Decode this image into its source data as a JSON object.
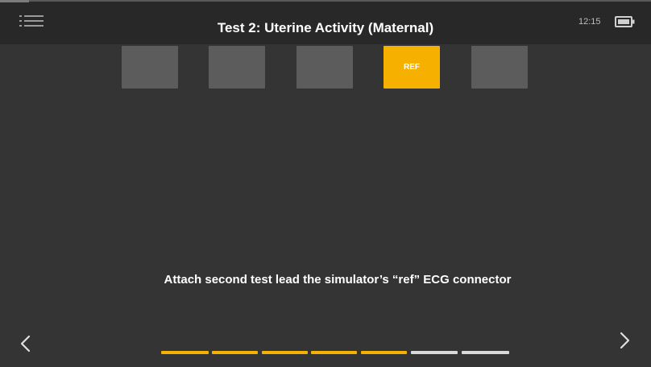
{
  "header": {
    "title": "Test 2: Uterine Activity (Maternal)",
    "time": "12:15",
    "menu_icon": "hamburger-list-icon",
    "battery_icon": "battery-icon"
  },
  "steps": [
    {
      "label": "",
      "active": false
    },
    {
      "label": "",
      "active": false
    },
    {
      "label": "",
      "active": false
    },
    {
      "label": "REF",
      "active": true
    },
    {
      "label": "",
      "active": false
    }
  ],
  "instruction": "Attach second test lead the simulator’s “ref” ECG connector",
  "navigation": {
    "prev_icon": "chevron-left-icon",
    "next_icon": "chevron-right-icon"
  },
  "progress": {
    "total_segments": 7,
    "completed_segments": 5
  },
  "colors": {
    "accent": "#f5b000",
    "background": "#343434",
    "header": "#282828",
    "step_inactive": "#5c5c5c",
    "progress_todo": "#d9d9d9"
  }
}
